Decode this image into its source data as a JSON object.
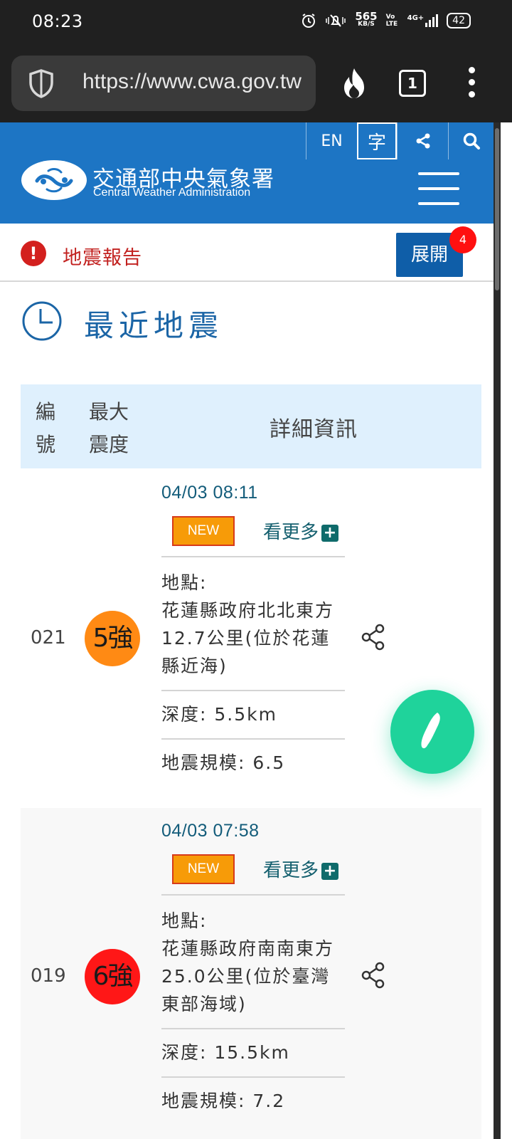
{
  "status_bar": {
    "time": "08:23",
    "net_speed": "565",
    "net_unit": "KB/S",
    "volte": "Vo LTE",
    "network": "4G+",
    "battery": "42"
  },
  "browser": {
    "url": "https://www.cwa.gov.tw",
    "tab_count": "1"
  },
  "header": {
    "lang_en": "EN",
    "font_size": "字",
    "brand_zh": "交通部中央氣象署",
    "brand_en": "Central Weather Administration",
    "accent_color": "#1d75c4"
  },
  "alert": {
    "label": "地震報告",
    "expand_label": "展開",
    "badge_count": "4"
  },
  "section": {
    "title": "最近地震"
  },
  "table": {
    "col_no": "編號",
    "col_max": "最大震度",
    "col_detail": "詳細資訊"
  },
  "quakes": [
    {
      "no": "021",
      "intensity": "5強",
      "intensity_color": "#ff8a14",
      "datetime": "04/03 08:11",
      "tag": "NEW",
      "more": "看更多",
      "location": "地點:\n花蓮縣政府北北東方12.7公里(位於花蓮縣近海)",
      "depth": "深度: 5.5km",
      "magnitude": "地震規模: 6.5"
    },
    {
      "no": "019",
      "intensity": "6強",
      "intensity_color": "#ff1717",
      "datetime": "04/03 07:58",
      "tag": "NEW",
      "more": "看更多",
      "location": "地點:\n花蓮縣政府南南東方25.0公里(位於臺灣東部海域)",
      "depth": "深度: 15.5km",
      "magnitude": "地震規模: 7.2"
    }
  ]
}
